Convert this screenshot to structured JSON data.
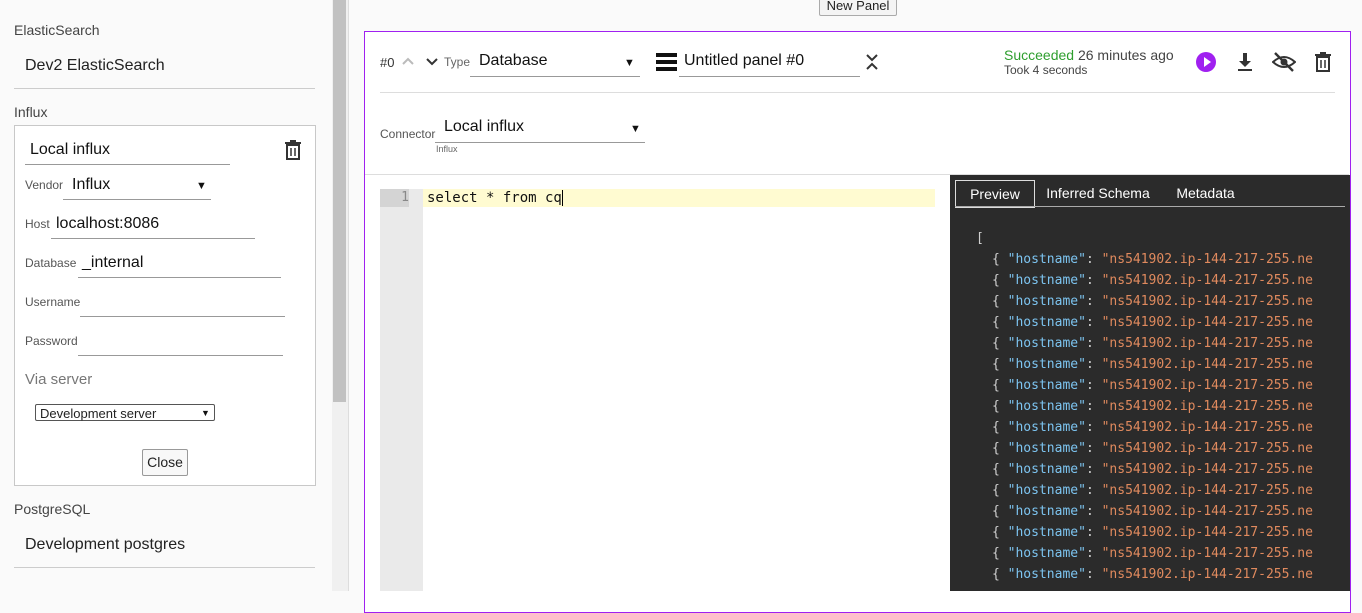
{
  "sidebar": {
    "sections": {
      "elastic": {
        "label": "ElasticSearch",
        "item": "Dev2 ElasticSearch"
      },
      "influx": {
        "label": "Influx"
      },
      "postgres": {
        "label": "PostgreSQL",
        "item": "Development postgres"
      }
    },
    "edit": {
      "name": "Local influx",
      "vendor_label": "Vendor",
      "vendor_value": "Influx",
      "host_label": "Host",
      "host_value": "localhost:8086",
      "database_label": "Database",
      "database_value": "_internal",
      "username_label": "Username",
      "username_value": "",
      "password_label": "Password",
      "password_value": "",
      "via_server_label": "Via server",
      "via_server_value": "Development server",
      "close_label": "Close"
    }
  },
  "toolbar": {
    "new_panel_label": "New Panel"
  },
  "panel": {
    "index": "#0",
    "type_label": "Type",
    "type_value": "Database",
    "title": "Untitled panel #0",
    "status_succeeded": "Succeeded",
    "status_time": "26 minutes ago",
    "status_took": "Took 4 seconds",
    "connector_label": "Connector",
    "connector_value": "Local influx",
    "connector_sub": "Influx",
    "accent_color": "#a020f0"
  },
  "editor": {
    "line_number": "1",
    "code": "select * from cq"
  },
  "results": {
    "tabs": [
      "Preview",
      "Inferred Schema",
      "Metadata"
    ],
    "open_bracket": "[",
    "row_key": "\"hostname\"",
    "row_value": "\"ns541902.ip-144-217-255.ne",
    "row_count": 16
  },
  "icons": [
    "chevron-up-icon",
    "chevron-down-icon",
    "menu-icon",
    "collapse-icon",
    "play-icon",
    "download-icon",
    "eye-off-icon",
    "trash-icon"
  ]
}
